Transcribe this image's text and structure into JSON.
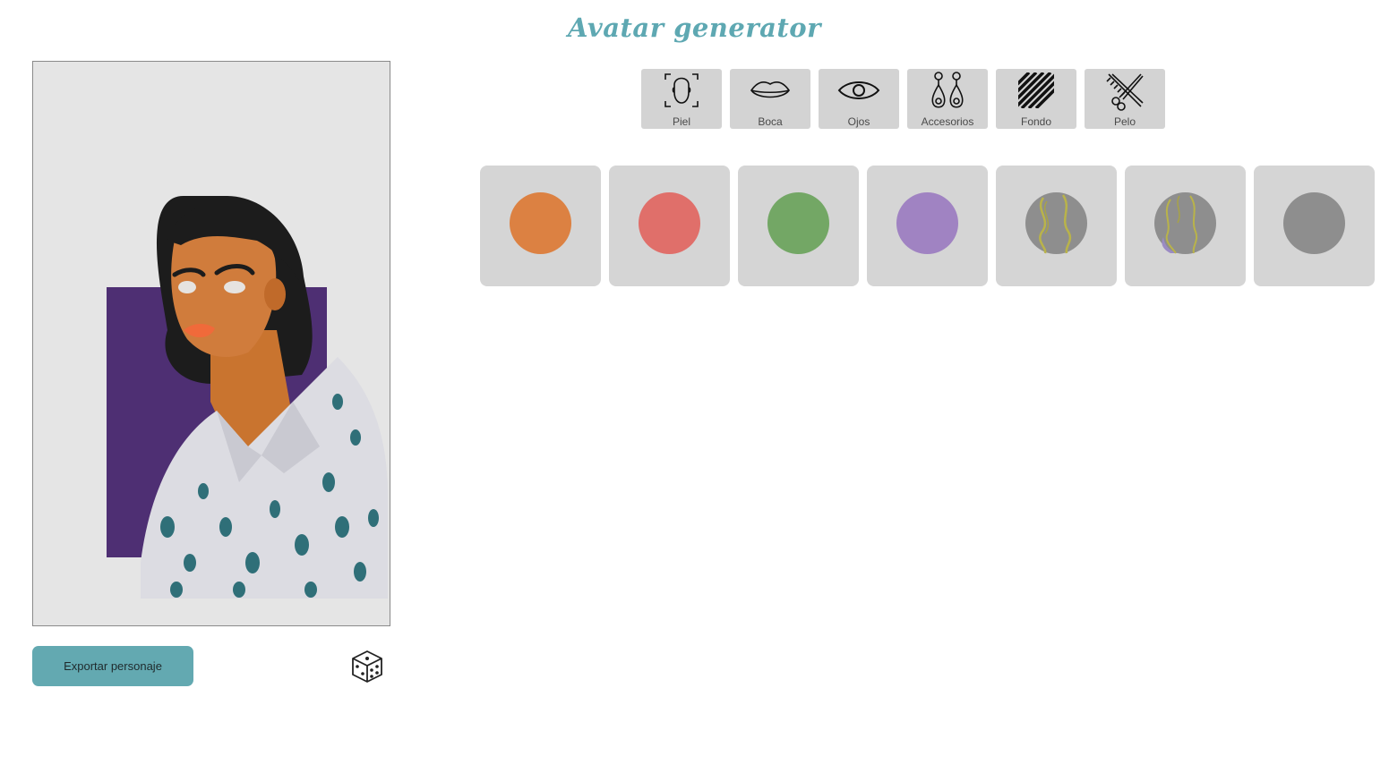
{
  "header": {
    "title": "Avatar generator"
  },
  "preview": {
    "background_color": "#e5e5e5",
    "backdrop_color": "#4e2f73",
    "hair_color": "#1c1c1c",
    "skin_color": "#d07c3c",
    "lips_color": "#f06a3a",
    "shirt_color": "#dcdce2",
    "print_color": "#2f6f78"
  },
  "actions": {
    "export_label": "Exportar personaje",
    "randomize_icon": "dice-icon"
  },
  "tabs": [
    {
      "label": "Piel",
      "icon": "face-scan-icon"
    },
    {
      "label": "Boca",
      "icon": "lips-icon"
    },
    {
      "label": "Ojos",
      "icon": "eye-icon"
    },
    {
      "label": "Accesorios",
      "icon": "earrings-icon"
    },
    {
      "label": "Fondo",
      "icon": "stripes-icon"
    },
    {
      "label": "Pelo",
      "icon": "scissors-comb-icon"
    }
  ],
  "swatches": [
    {
      "color": "#dc8142"
    },
    {
      "color": "#e06f6a"
    },
    {
      "color": "#73a765"
    },
    {
      "color": "#a083c2"
    },
    {
      "color": "#8e8e8e",
      "pattern": "yellow-lines"
    },
    {
      "color": "#8e8e8e",
      "pattern": "yellow-purple-lines"
    },
    {
      "color": "#8e8e8e"
    }
  ]
}
